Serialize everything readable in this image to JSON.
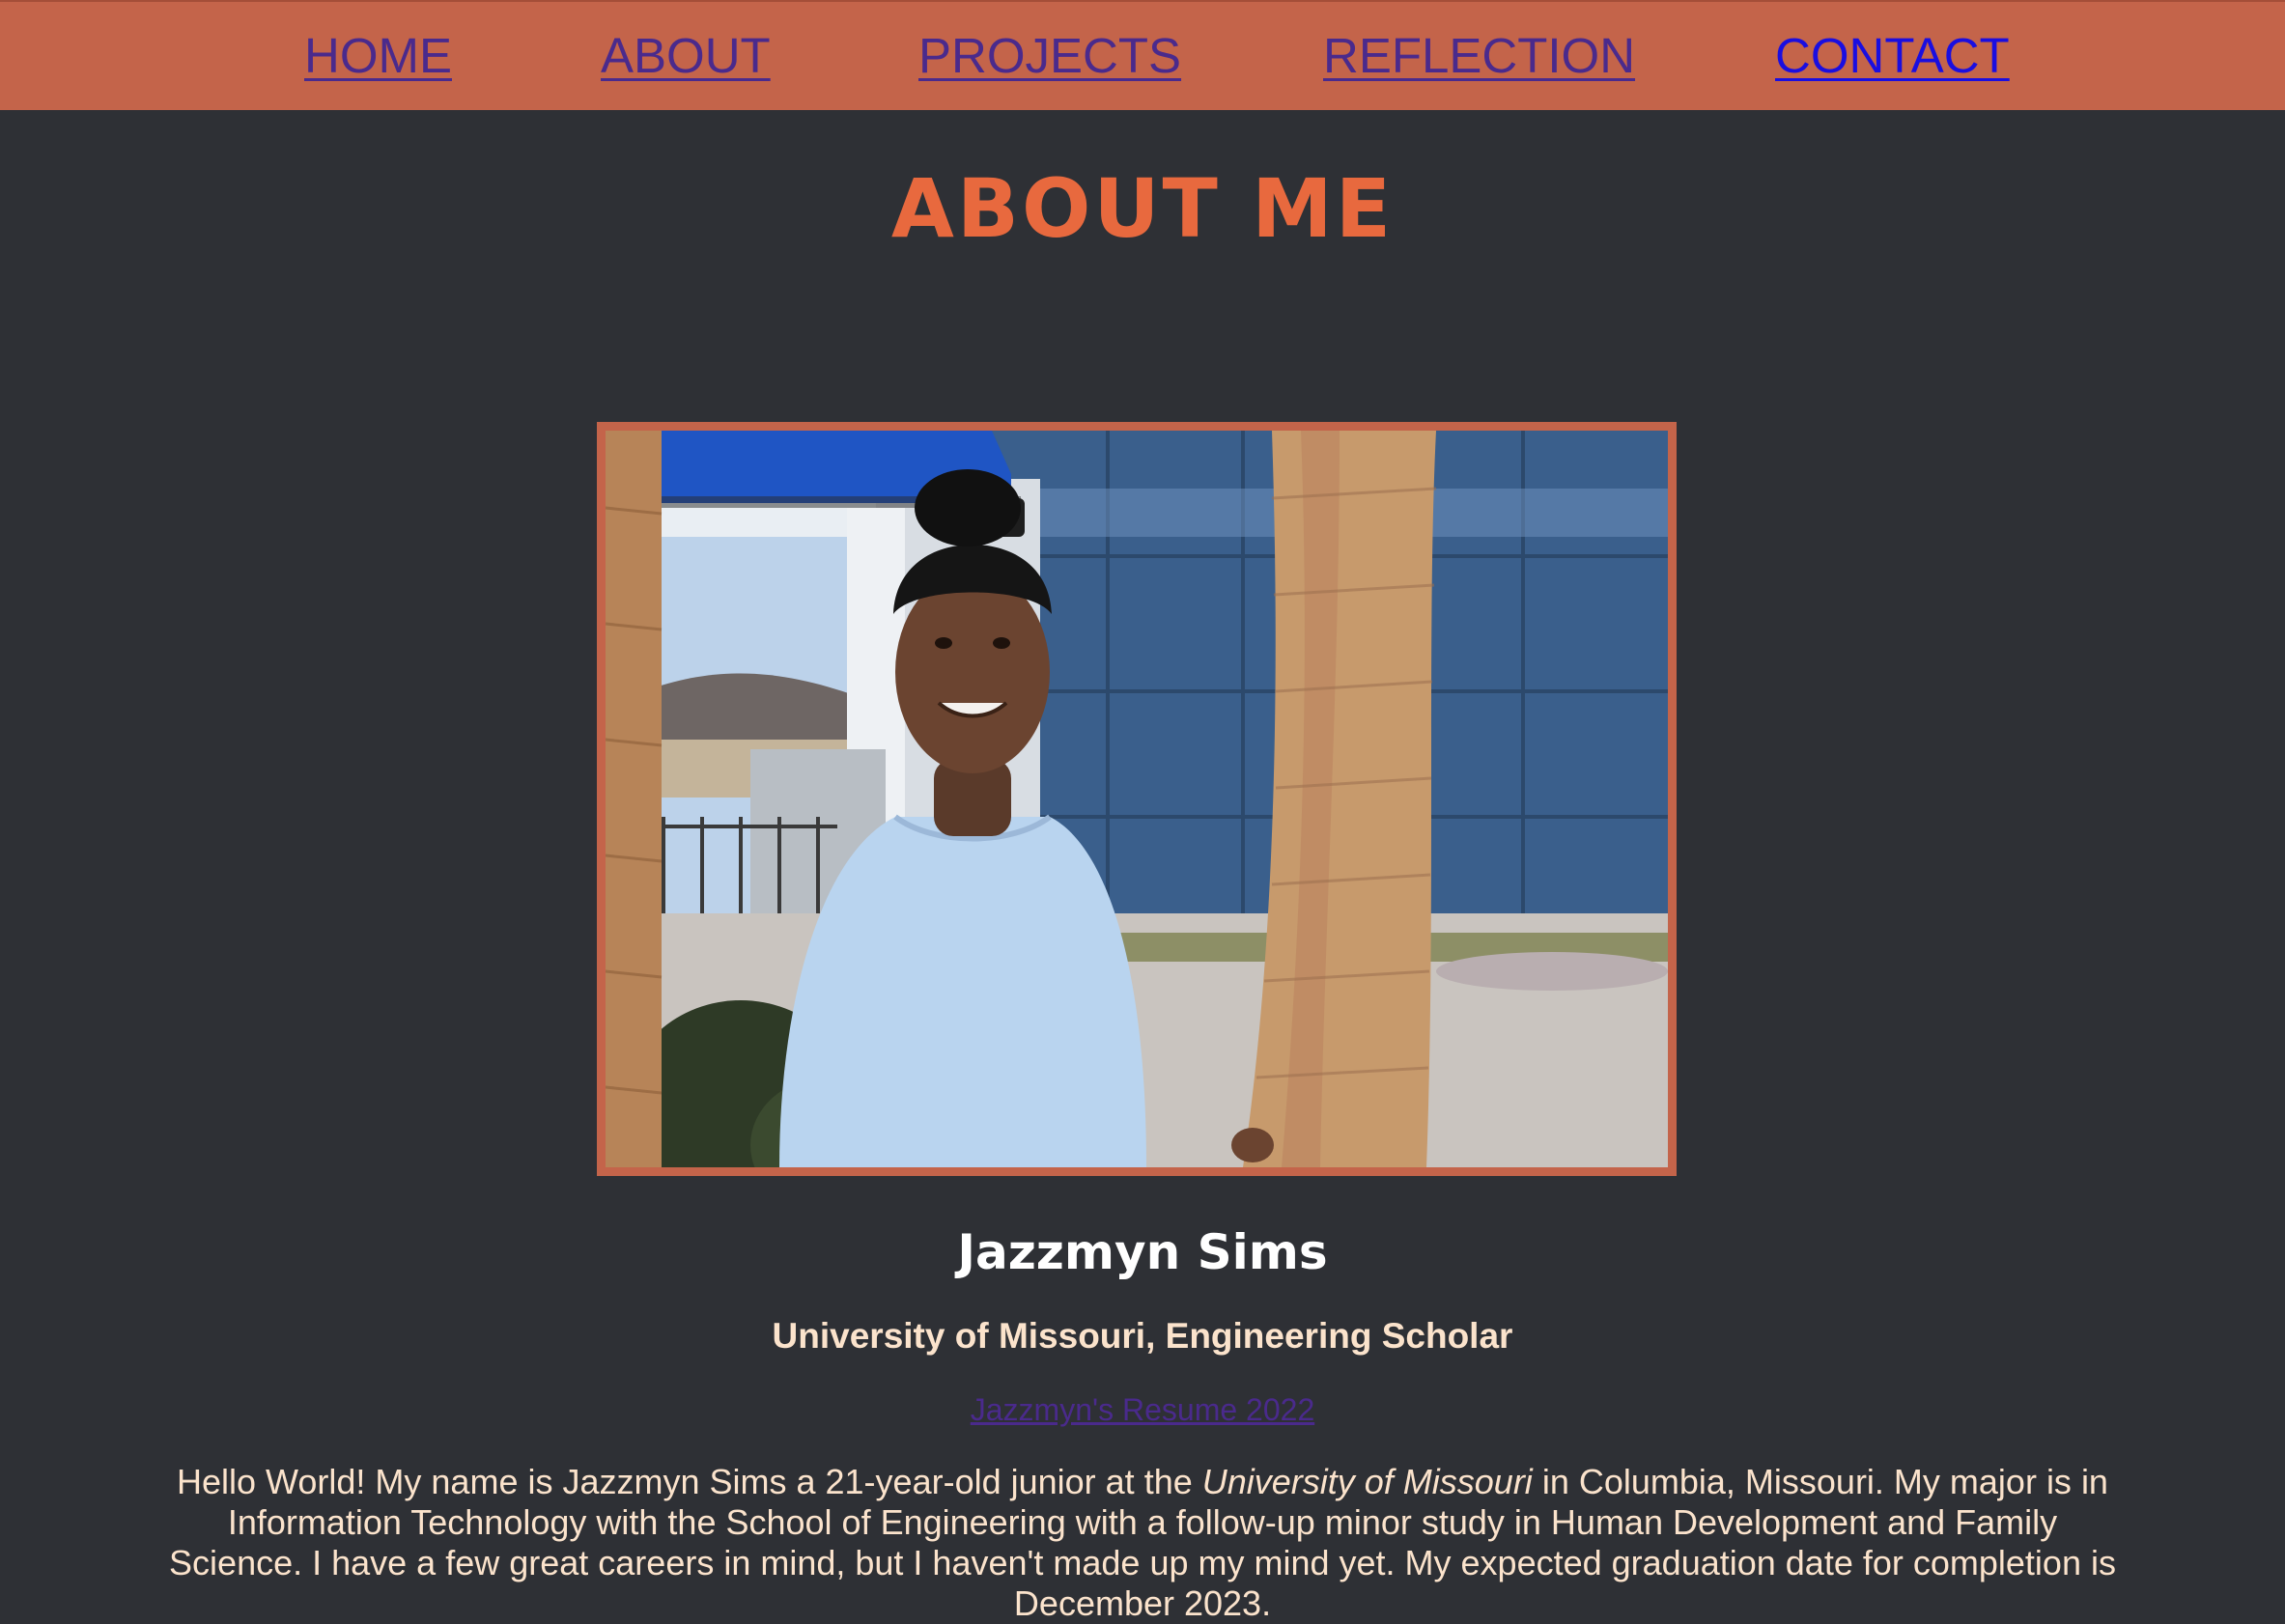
{
  "nav": {
    "home": "HOME",
    "about": "ABOUT",
    "projects": "PROJECTS",
    "reflection": "REFLECTION",
    "contact": "CONTACT"
  },
  "page": {
    "title": "ABOUT ME"
  },
  "profile": {
    "photo_alt": "Photo of Jazzmyn Sims",
    "name": "Jazzmyn Sims",
    "subtitle": "University of Missouri, Engineering Scholar",
    "resume_link": "Jazzmyn's Resume 2022"
  },
  "bio": {
    "part1": "Hello World! My name is Jazzmyn Sims a 21-year-old junior at the ",
    "university": "University of Missouri",
    "part2": " in Columbia, Missouri. My major is in Information Technology with the School of Engineering with a follow-up minor study in Human Development and Family Science. I have a few great careers in mind, but I haven't made up my mind yet. My expected graduation date for completion is December 2023."
  },
  "colors": {
    "background": "#2e3035",
    "nav_bar": "#c4644a",
    "title_accent": "#e8693e",
    "link_visited": "#4a2a8c",
    "link_unvisited": "#1a0ee0",
    "body_text": "#fbe3cc"
  }
}
